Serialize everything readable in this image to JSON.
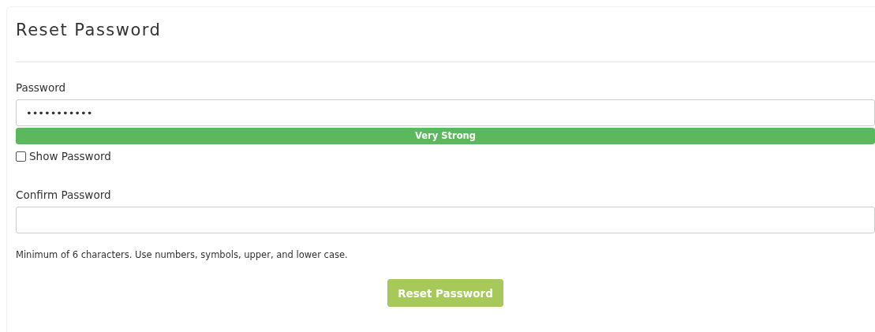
{
  "title": "Reset Password",
  "password": {
    "label": "Password",
    "value": "•••••••••••",
    "strength": {
      "label": "Very Strong",
      "level": 1
    }
  },
  "show_password": {
    "label": "Show Password",
    "checked": false
  },
  "confirm": {
    "label": "Confirm Password"
  },
  "hint": "Minimum of 6 characters. Use numbers, symbols, upper, and lower case.",
  "submit": {
    "label": "Reset Password",
    "disabled": true
  }
}
